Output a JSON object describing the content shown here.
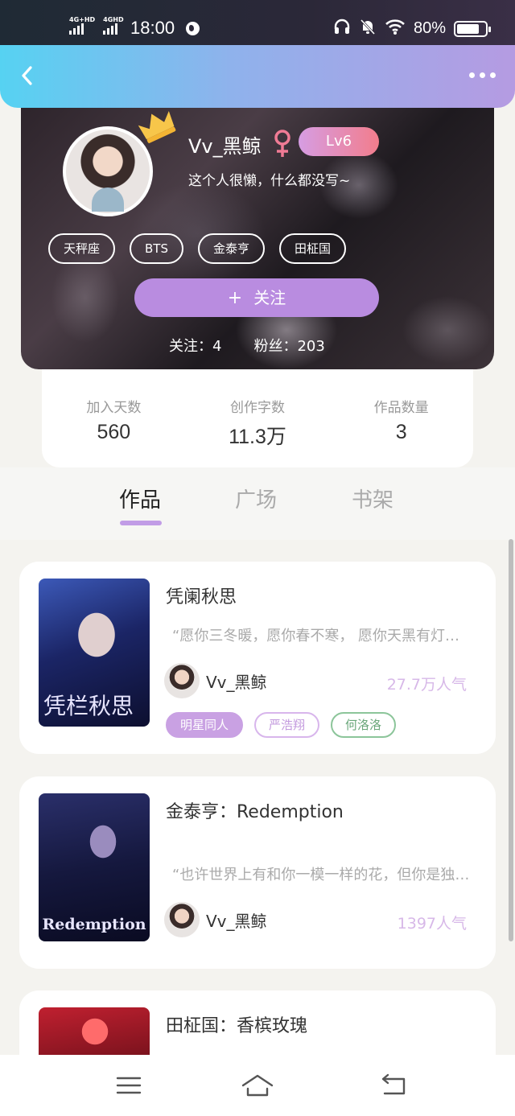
{
  "status_bar": {
    "net1": "4G+HD",
    "net2": "4GHD",
    "time": "18:00",
    "battery_text": "80%",
    "battery_level": 0.8
  },
  "header": {
    "back_icon": "chevron-left-icon",
    "more_icon": "more-dots-icon"
  },
  "profile": {
    "nickname": "Vv_黑鲸",
    "level": "Lv6",
    "bio": "这个人很懒，什么都没写~",
    "tags": [
      "天秤座",
      "BTS",
      "金泰亨",
      "田柾国"
    ],
    "follow_plus": "+",
    "follow_label": "关注",
    "following": "关注：4",
    "followers": "粉丝：203"
  },
  "stats": [
    {
      "label": "加入天数",
      "value": "560"
    },
    {
      "label": "创作字数",
      "value": "11.3万"
    },
    {
      "label": "作品数量",
      "value": "3"
    }
  ],
  "tabs": [
    {
      "label": "作品",
      "active": true
    },
    {
      "label": "广场",
      "active": false
    },
    {
      "label": "书架",
      "active": false
    }
  ],
  "works": [
    {
      "title": "凭阑秋思",
      "cover_text": "凭栏秋思",
      "quote": "“愿你三冬暖，愿你春不寒， 愿你天黑有灯，下雨有伞”",
      "author": "Vv_黑鲸",
      "popularity": "27.7万人气",
      "tags": [
        "明星同人",
        "严浩翔",
        "何洛洛"
      ]
    },
    {
      "title": "金泰亨：Redemption",
      "cover_text": "Redemption",
      "quote": "“也许世界上有和你一模一样的花，但你是独一无二的”",
      "author": "Vv_黑鲸",
      "popularity": "1397人气"
    },
    {
      "title": "田柾国：香槟玫瑰"
    }
  ],
  "colors": {
    "accent": "#b98ce0",
    "header_start": "#56d2f2",
    "header_end": "#b59be2",
    "popularity": "#d7b8e8"
  },
  "bottom_nav": [
    "menu-icon",
    "home-icon",
    "back-icon"
  ]
}
